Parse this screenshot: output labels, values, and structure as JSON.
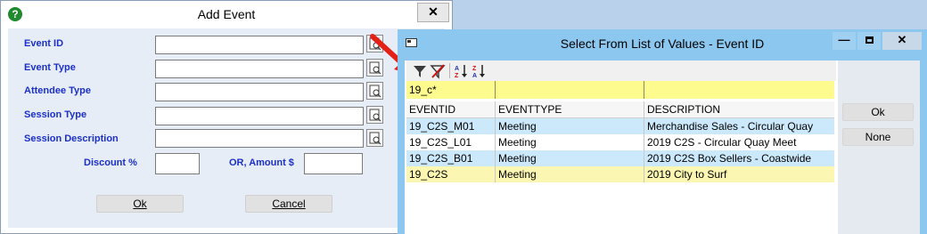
{
  "add_event": {
    "title": "Add Event",
    "close_glyph": "✕",
    "help_glyph": "?",
    "labels": {
      "event_id": "Event ID",
      "event_type": "Event Type",
      "attendee_type": "Attendee Type",
      "session_type": "Session Type",
      "session_description": "Session Description",
      "discount": "Discount %",
      "amount": "OR, Amount $"
    },
    "values": {
      "event_id": "",
      "event_type": "",
      "attendee_type": "",
      "session_type": "",
      "session_description": "",
      "discount": "",
      "amount": ""
    },
    "ok_label": "Ok",
    "cancel_label": "Cancel"
  },
  "lov": {
    "title": "Select From List of Values - Event ID",
    "min_glyph": "—",
    "close_glyph": "✕",
    "filter": [
      "19_c*",
      "",
      ""
    ],
    "columns": [
      "EVENTID",
      "EVENTTYPE",
      "DESCRIPTION"
    ],
    "rows": [
      {
        "eventid": "19_C2S_M01",
        "eventtype": "Meeting",
        "description": "Merchandise Sales - Circular Quay"
      },
      {
        "eventid": "19_C2S_L01",
        "eventtype": "Meeting",
        "description": "2019 C2S - Circular Quay Meet"
      },
      {
        "eventid": "19_C2S_B01",
        "eventtype": "Meeting",
        "description": "2019 C2S Box Sellers - Coastwide"
      },
      {
        "eventid": "19_C2S",
        "eventtype": "Meeting",
        "description": "2019 City to Surf"
      }
    ],
    "ok_label": "Ok",
    "none_label": "None",
    "icons": [
      "filter-icon",
      "clear-filter-icon",
      "sort-ascending-icon",
      "sort-descending-icon"
    ]
  },
  "colors": {
    "label_blue": "#1a30c8",
    "filter_yellow": "#fdfa8e",
    "row_blue": "#cce8fb",
    "row_selected": "#fbf7b2",
    "title_active": "#8cc7f0",
    "arrow_red": "#e32116"
  }
}
